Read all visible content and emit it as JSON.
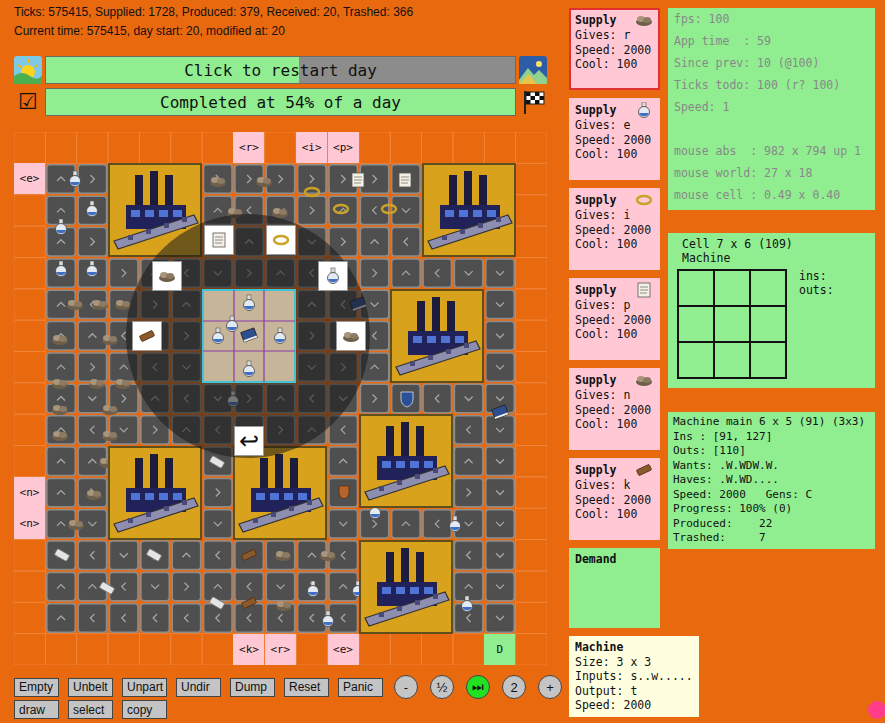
{
  "stats": {
    "ticks_line": "Ticks: 575415, Supplied: 1728, Produced: 379, Received: 20, Trashed: 366",
    "time_line": "Current time: 575415, day start: 20, modified at: 20"
  },
  "day_bar": {
    "label": "Click to restart day",
    "level": 0.54
  },
  "completion": {
    "check_glyph": "☑",
    "checked": true,
    "label": "Completed at 54% of a day",
    "level": 1
  },
  "board": {
    "edge_labels": [
      {
        "text": "<r>",
        "kind": "supply"
      },
      {
        "text": "<i>",
        "kind": "supply"
      },
      {
        "text": "<p>",
        "kind": "supply"
      },
      {
        "text": "<e>",
        "kind": "supply"
      },
      {
        "text": "<n>",
        "kind": "supply"
      },
      {
        "text": "<n>",
        "kind": "supply"
      },
      {
        "text": "<k>",
        "kind": "supply"
      },
      {
        "text": "<r>",
        "kind": "supply"
      },
      {
        "text": "<e>",
        "kind": "supply"
      },
      {
        "text": "D",
        "kind": "demand"
      }
    ],
    "machines": [
      {
        "selected": false
      },
      {
        "selected": false
      },
      {
        "selected": false
      },
      {
        "selected": true
      },
      {
        "selected": false
      },
      {
        "selected": false
      },
      {
        "selected": false
      },
      {
        "selected": false
      }
    ],
    "radial_menu": {
      "open": true,
      "back_glyph": "↩"
    }
  },
  "supply_cards": [
    {
      "title": "Supply",
      "gives": "Gives: r",
      "speed": "Speed: 2000",
      "cool": "Cool: 100",
      "selected": true
    },
    {
      "title": "Supply",
      "gives": "Gives: e",
      "speed": "Speed: 2000",
      "cool": "Cool: 100",
      "selected": false
    },
    {
      "title": "Supply",
      "gives": "Gives: i",
      "speed": "Speed: 2000",
      "cool": "Cool: 100",
      "selected": false
    },
    {
      "title": "Supply",
      "gives": "Gives: p",
      "speed": "Speed: 2000",
      "cool": "Cool: 100",
      "selected": false
    },
    {
      "title": "Supply",
      "gives": "Gives: n",
      "speed": "Speed: 2000",
      "cool": "Cool: 100",
      "selected": false
    },
    {
      "title": "Supply",
      "gives": "Gives: k",
      "speed": "Speed: 2000",
      "cool": "Cool: 100",
      "selected": false
    }
  ],
  "demand_card": {
    "title": "Demand"
  },
  "machine_card": {
    "title": "Machine",
    "lines": [
      "Size: 3 x 3",
      "Inputs: s..w.....",
      "Output: t",
      "Speed: 2000"
    ]
  },
  "debug": {
    "lines": [
      "fps: 100",
      "App time  : 59",
      "Since prev: 10 (@100)",
      "Ticks todo: 100 (r? 100)",
      "Speed: 1"
    ],
    "mouse_lines": [
      "mouse abs  : 982 x 794 up 1",
      "mouse world: 27 x 18",
      "mouse cell : 0.49 x 0.40"
    ]
  },
  "cell_panel": {
    "title": "Cell 7 x 6 (109)",
    "kind_label": "Machine",
    "ins": "ins:",
    "outs": "outs:"
  },
  "machine_panel": {
    "lines": [
      "Machine main 6 x 5 (91) (3x3)",
      "Ins : [91, 127]",
      "Outs: [110]",
      "Wants: .W.WDW.W.",
      "Haves: .W.WD....",
      "Speed: 2000   Gens: C",
      "Progress: 100% (0)",
      "Produced:    22",
      "Trashed:     7"
    ]
  },
  "action_buttons": [
    "Empty",
    "Unbelt",
    "Unpart",
    "Undir",
    "Dump",
    "Reset",
    "Panic"
  ],
  "speed_buttons": [
    {
      "label": "-",
      "selected": false
    },
    {
      "label": "½",
      "selected": false
    },
    {
      "label": "⏭",
      "selected": true
    },
    {
      "label": "2",
      "selected": false
    },
    {
      "label": "+",
      "selected": false
    }
  ],
  "tool_buttons": [
    "draw",
    "select",
    "copy"
  ]
}
